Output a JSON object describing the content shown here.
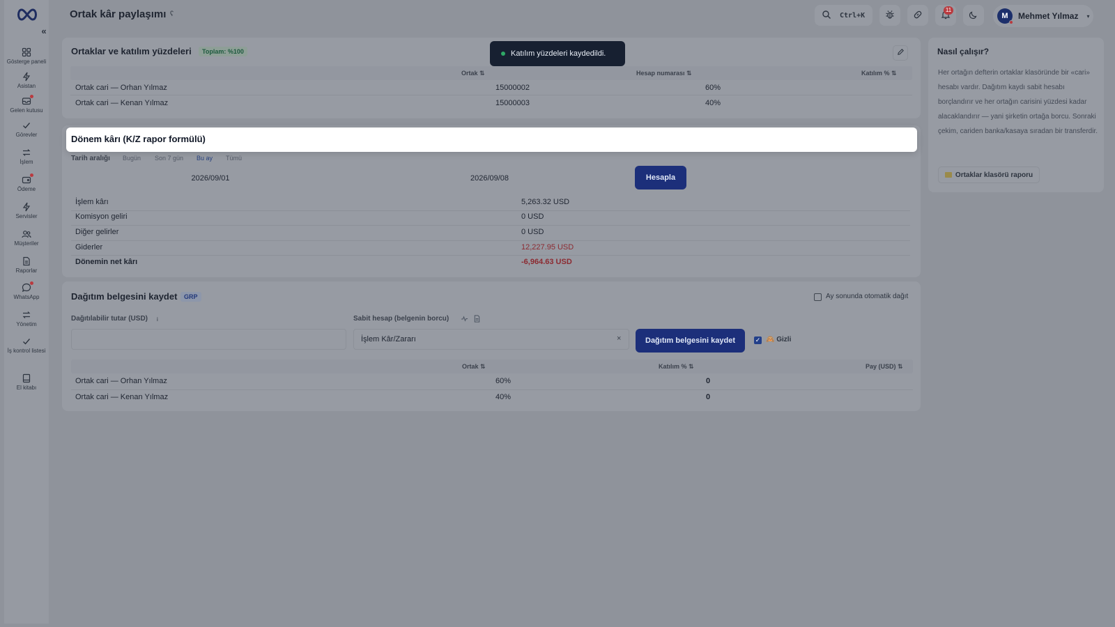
{
  "colors": {
    "accent": "#1c2f7a",
    "negative": "#8c2a31",
    "toast_bg": "#172031",
    "success_dot": "#2fa866"
  },
  "sidebar": {
    "logo": "infinity-logo",
    "collapse_icon": "«",
    "items": [
      {
        "label": "Gösterge paneli",
        "icon": "grid-icon"
      },
      {
        "label": "Asistan",
        "icon": "bolt-icon"
      },
      {
        "label": "Gelen kutusu",
        "icon": "inbox-icon"
      },
      {
        "label": "Görevler",
        "icon": "check-icon"
      },
      {
        "label": "İşlem",
        "icon": "swap-icon"
      },
      {
        "label": "Ödeme",
        "icon": "wallet-icon"
      },
      {
        "label": "Servisler",
        "icon": "bolt-icon"
      },
      {
        "label": "Müşteriler",
        "icon": "users-icon"
      },
      {
        "label": "Raporlar",
        "icon": "file-icon"
      },
      {
        "label": "WhatsApp",
        "icon": "chat-icon"
      },
      {
        "label": "Yönetim",
        "icon": "swap-icon"
      },
      {
        "label": "İş kontrol listesi",
        "icon": "check-icon"
      },
      {
        "label": "El kitabı",
        "icon": "book-icon"
      }
    ]
  },
  "header": {
    "title": "Ortak kâr paylaşımı",
    "title_info": "ʕ",
    "search_shortcut": "Ctrl+K",
    "notification_count": "11",
    "user": {
      "initial": "M",
      "name": "Mehmet Yılmaz",
      "caret": "▾"
    }
  },
  "toast": {
    "message": "Katılım yüzdeleri kaydedildi."
  },
  "partners_card": {
    "title": "Ortaklar ve katılım yüzdeleri",
    "total_badge": "Toplam: %100",
    "columns": [
      "Ortak ⇅",
      "Hesap numarası ⇅",
      "Katılım % ⇅"
    ],
    "rows": [
      {
        "partner": "Ortak cari — Orhan Yılmaz",
        "account": "15000002",
        "share": "60%"
      },
      {
        "partner": "Ortak cari — Kenan Yılmaz",
        "account": "15000003",
        "share": "40%"
      }
    ]
  },
  "profit_card": {
    "title": "Dönem kârı (K/Z rapor formülü)",
    "range_label": "Tarih aralığı",
    "range_options": [
      "Bugün",
      "Son 7 gün",
      "Bu ay",
      "Tümü"
    ],
    "range_active": "Bu ay",
    "date_from": "2026/09/01",
    "date_to": "2026/09/08",
    "calc_button": "Hesapla",
    "lines": [
      {
        "label": "İşlem kârı",
        "value": "5,263.32 USD"
      },
      {
        "label": "Komisyon geliri",
        "value": "0 USD"
      },
      {
        "label": "Diğer gelirler",
        "value": "0 USD"
      },
      {
        "label": "Giderler",
        "value": "12,227.95 USD"
      },
      {
        "label": "Dönemin net kârı",
        "value": "-6,964.63 USD"
      }
    ]
  },
  "distribution_card": {
    "title": "Dağıtım belgesini kaydet",
    "badge": "GRP",
    "auto_distribute_label": "Ay sonunda otomatik dağıt",
    "amount_label": "Dağıtılabilir tutar (USD)",
    "amount_info": "i",
    "amount_value": "",
    "fixed_account_label": "Sabit hesap (belgenin borcu)",
    "fixed_account_value": "İşlem Kâr/Zararı",
    "clear": "×",
    "save_button": "Dağıtım belgesini kaydet",
    "hidden_label": "🙈 Gizli",
    "columns": [
      "Ortak ⇅",
      "Katılım % ⇅",
      "Pay (USD) ⇅"
    ],
    "rows": [
      {
        "partner": "Ortak cari — Orhan Yılmaz",
        "share": "60%",
        "amount": "0"
      },
      {
        "partner": "Ortak cari — Kenan Yılmaz",
        "share": "40%",
        "amount": "0"
      }
    ]
  },
  "help_card": {
    "title": "Nasıl çalışır?",
    "text": "Her ortağın defterin ortaklar klasöründe bir «cari» hesabı vardır. Dağıtım kaydı sabit hesabı borçlandırır ve her ortağın carisini yüzdesi kadar alacaklandırır — yani şirketin ortağa borcu. Sonraki çekim, cariden banka/kasaya sıradan bir transferdir.",
    "report_button": "Ortaklar klasörü raporu"
  }
}
